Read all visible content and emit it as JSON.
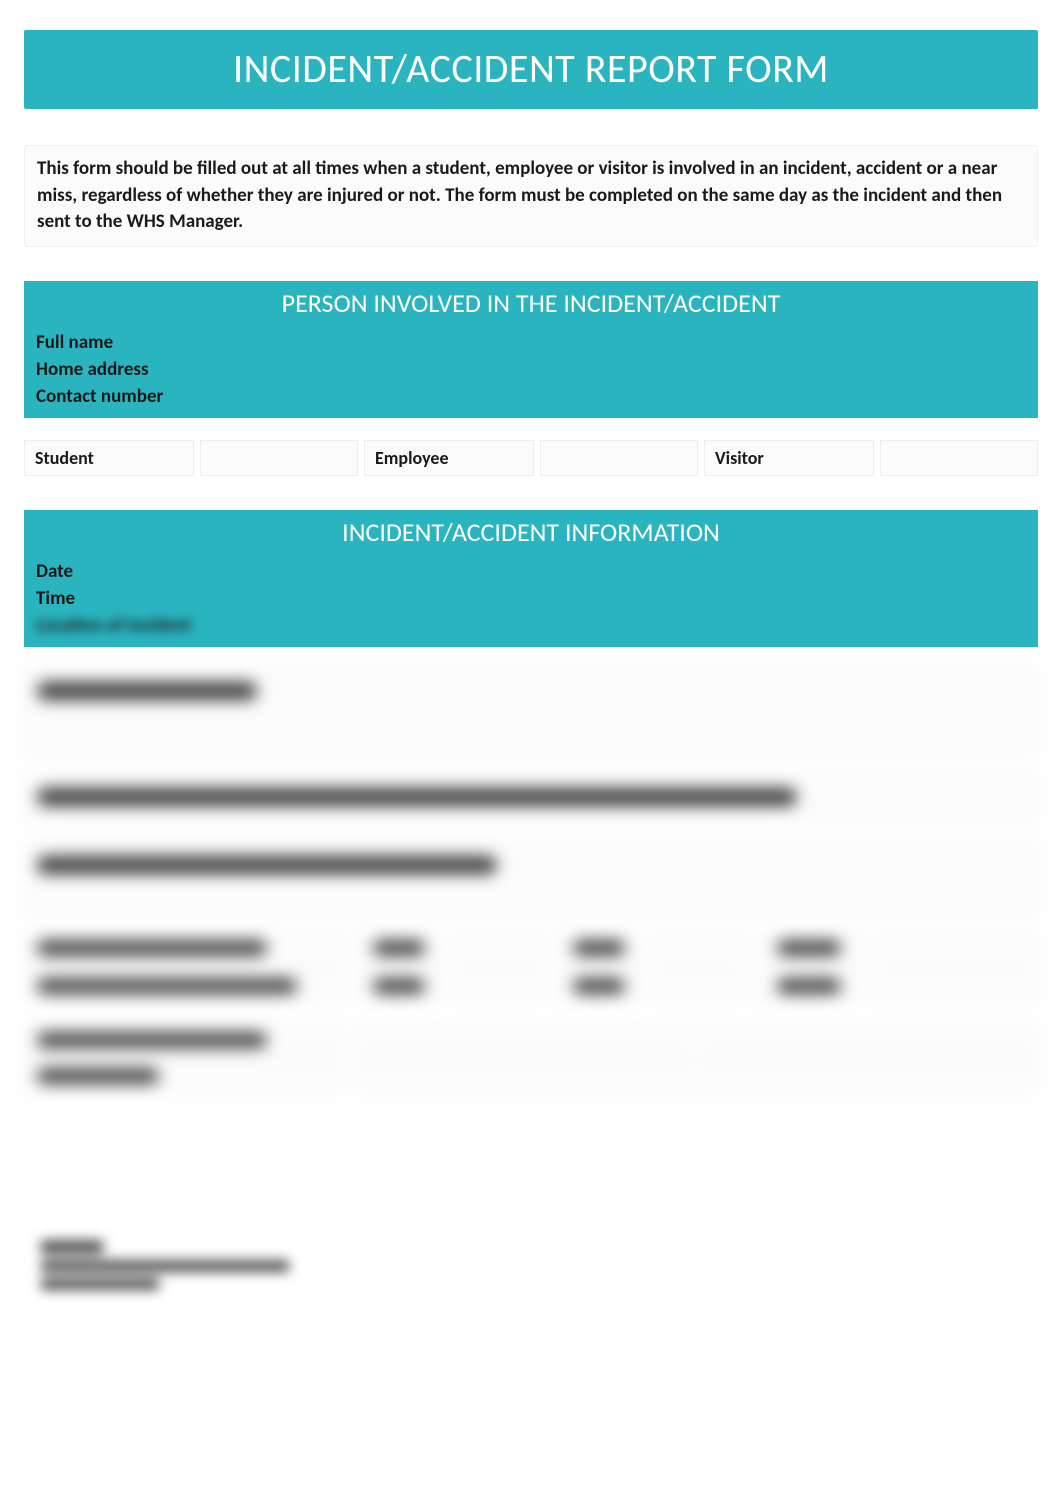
{
  "title": "INCIDENT/ACCIDENT REPORT FORM",
  "instructions": "This form should be filled out at all times when a student, employee or visitor is involved in an incident, accident or a near miss, regardless of whether they are injured or not. The form must be completed on the same day as the incident and then sent to the WHS Manager.",
  "section_person": {
    "heading": "PERSON INVOLVED IN THE INCIDENT/ACCIDENT",
    "fields": {
      "full_name": "Full name",
      "home_address": "Home address",
      "contact_number": "Contact number"
    },
    "roles": {
      "student": "Student",
      "employee": "Employee",
      "visitor": "Visitor"
    }
  },
  "section_info": {
    "heading": "INCIDENT/ACCIDENT INFORMATION",
    "fields": {
      "date": "Date",
      "time": "Time",
      "location": "Location of incident"
    }
  },
  "blurred": {
    "description_label": "Incident Description",
    "witnesses_q": "Were there witnesses to the incident/accident? If yes, please place their details in the box below.",
    "injured_q": "Was the individual injured? If so, please outline details below.",
    "treatment_q": "Was treatment provided?",
    "where_treatment_q": "Where was treatment provided?",
    "yes": "Yes",
    "no": "No",
    "onsite": "Onsite",
    "hospital": "Hospital",
    "refused": "Refused",
    "other": "Other",
    "reporter_name": "Name of reporting person",
    "date_of_report": "Date of report"
  }
}
